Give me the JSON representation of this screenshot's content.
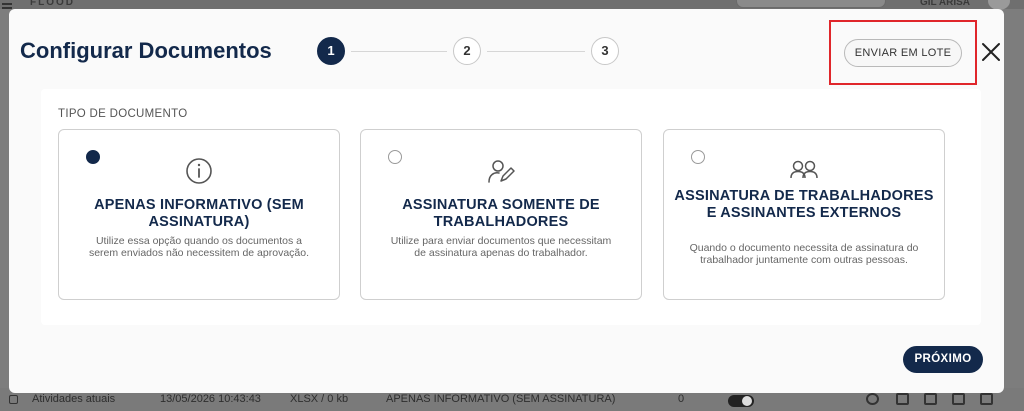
{
  "background": {
    "logo": "FLOOD",
    "user": "GIL ARISA",
    "row": {
      "name": "Atividades atuais",
      "date": "13/05/2026 10:43:43",
      "file": "XLSX / 0 kb",
      "type": "APENAS INFORMATIVO (SEM ASSINATURA)",
      "count": "0"
    }
  },
  "modal": {
    "title": "Configurar Documentos",
    "steps": [
      "1",
      "2",
      "3"
    ],
    "active_step": 1,
    "batch_button": "ENVIAR EM LOTE",
    "close_icon": "close-x-icon",
    "section_label": "TIPO DE DOCUMENTO",
    "options": [
      {
        "icon": "info-icon",
        "title": "APENAS INFORMATIVO (SEM ASSINATURA)",
        "description": "Utilize essa opção quando os documentos a serem enviados não necessitem de aprovação.",
        "selected": true
      },
      {
        "icon": "signature-pen-icon",
        "title": "ASSINATURA SOMENTE DE TRABALHADORES",
        "description": "Utilize para enviar documentos que necessitam de assinatura apenas do trabalhador.",
        "selected": false
      },
      {
        "icon": "users-icon",
        "title": "ASSINATURA DE TRABALHADORES E ASSINANTES EXTERNOS",
        "description": "Quando o documento necessita de assinatura do trabalhador juntamente com outras pessoas.",
        "selected": false
      }
    ],
    "next_button": "PRÓXIMO"
  },
  "colors": {
    "primary": "#13294b",
    "highlight": "#e0262b",
    "overlay": "#7d7d7d"
  }
}
